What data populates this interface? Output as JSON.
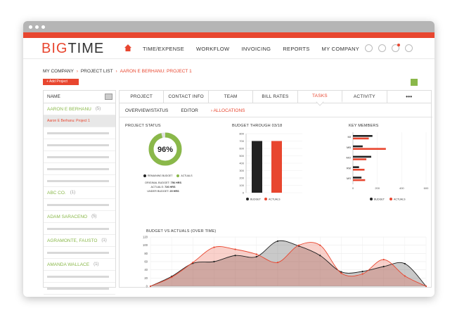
{
  "window": {
    "accent": "#e8462f",
    "green": "#8ab84a"
  },
  "logo": {
    "big": "BIG",
    "time": "TIME"
  },
  "nav": {
    "items": [
      "TIME/EXPENSE",
      "WORKFLOW",
      "INVOICING",
      "REPORTS",
      "MY COMPANY"
    ]
  },
  "breadcrumb": {
    "company": "MY COMPANY",
    "list": "PROJECT LIST",
    "current": "AARON E BERHANU: PROJECT 1"
  },
  "add_project": "+ Add Project",
  "sidebar": {
    "header": "NAME",
    "rows": [
      {
        "type": "person",
        "name": "AARON E BERHANU",
        "count": "(5)"
      },
      {
        "type": "selected",
        "name": "Aaron E Berhanu: Project 1"
      },
      {
        "type": "line"
      },
      {
        "type": "line"
      },
      {
        "type": "line"
      },
      {
        "type": "line"
      },
      {
        "type": "line"
      },
      {
        "type": "person",
        "name": "ABC CO.",
        "count": "(1)"
      },
      {
        "type": "line"
      },
      {
        "type": "person",
        "name": "ADAM SARACENO",
        "count": "(5)"
      },
      {
        "type": "line"
      },
      {
        "type": "person",
        "name": "AGRAMONTE, FAUSTO",
        "count": "(1)"
      },
      {
        "type": "line"
      },
      {
        "type": "person",
        "name": "AMANDA WALLACE",
        "count": "(1)"
      },
      {
        "type": "line"
      },
      {
        "type": "line"
      }
    ]
  },
  "tabs": [
    "PROJECT",
    "CONTACT INFO",
    "TEAM",
    "BILL RATES",
    "TASKS",
    "ACTIVITY",
    "•••"
  ],
  "active_tab": "TASKS",
  "subtabs": [
    "OVERVIEW/STATUS",
    "EDITOR",
    "ALLOCATIONS"
  ],
  "active_subtab": "ALLOCATIONS",
  "status": {
    "title": "PROJECT STATUS",
    "percent": "96%",
    "percent_value": 0.96,
    "legend": [
      "REMAINING BUDGET",
      "ACTUALS"
    ],
    "lines": [
      {
        "label": "ORIGINAL BUDGET:",
        "value": "756 HRS"
      },
      {
        "label": "ACTUALS:",
        "value": "726 HRS"
      },
      {
        "label": "UNDER BUDGET:",
        "value": "29 HRS"
      }
    ]
  },
  "chart_data": [
    {
      "type": "bar",
      "title": "BUDGET THROUGH 03/18",
      "categories": [
        ""
      ],
      "series": [
        {
          "name": "BUDGET",
          "values": [
            700
          ],
          "color": "#222222"
        },
        {
          "name": "ACTUALS",
          "values": [
            700
          ],
          "color": "#e8462f"
        }
      ],
      "ylim": [
        0,
        800
      ],
      "yticks": [
        0,
        100,
        200,
        300,
        400,
        500,
        600,
        700,
        800
      ]
    },
    {
      "type": "bar",
      "orientation": "horizontal",
      "title": "KEY MEMBERS",
      "categories": [
        "MI",
        "MB",
        "MO",
        "RM",
        "MS"
      ],
      "series": [
        {
          "name": "BUDGET",
          "values": [
            160,
            80,
            150,
            50,
            70
          ],
          "color": "#222222"
        },
        {
          "name": "ACTUALS",
          "values": [
            130,
            270,
            110,
            95,
            100
          ],
          "color": "#e8462f"
        }
      ],
      "xlim": [
        0,
        600
      ],
      "xticks": [
        0,
        200,
        400,
        600
      ]
    },
    {
      "type": "area",
      "title": "BUDGET VS ACTUALS (OVER TIME)",
      "x": [
        0,
        1,
        2,
        3,
        4,
        5,
        6,
        7,
        8,
        9,
        10,
        11,
        12,
        13
      ],
      "series": [
        {
          "name": "BUDGET",
          "values": [
            0,
            24,
            56,
            60,
            75,
            72,
            110,
            98,
            75,
            35,
            36,
            48,
            55,
            0
          ],
          "color": "#222222"
        },
        {
          "name": "ACTUALS",
          "values": [
            0,
            22,
            58,
            95,
            90,
            78,
            58,
            100,
            100,
            32,
            30,
            65,
            25,
            0
          ],
          "color": "#e8462f"
        }
      ],
      "ylim": [
        0,
        120
      ],
      "yticks": [
        0,
        20,
        40,
        60,
        80,
        100,
        120
      ]
    }
  ]
}
